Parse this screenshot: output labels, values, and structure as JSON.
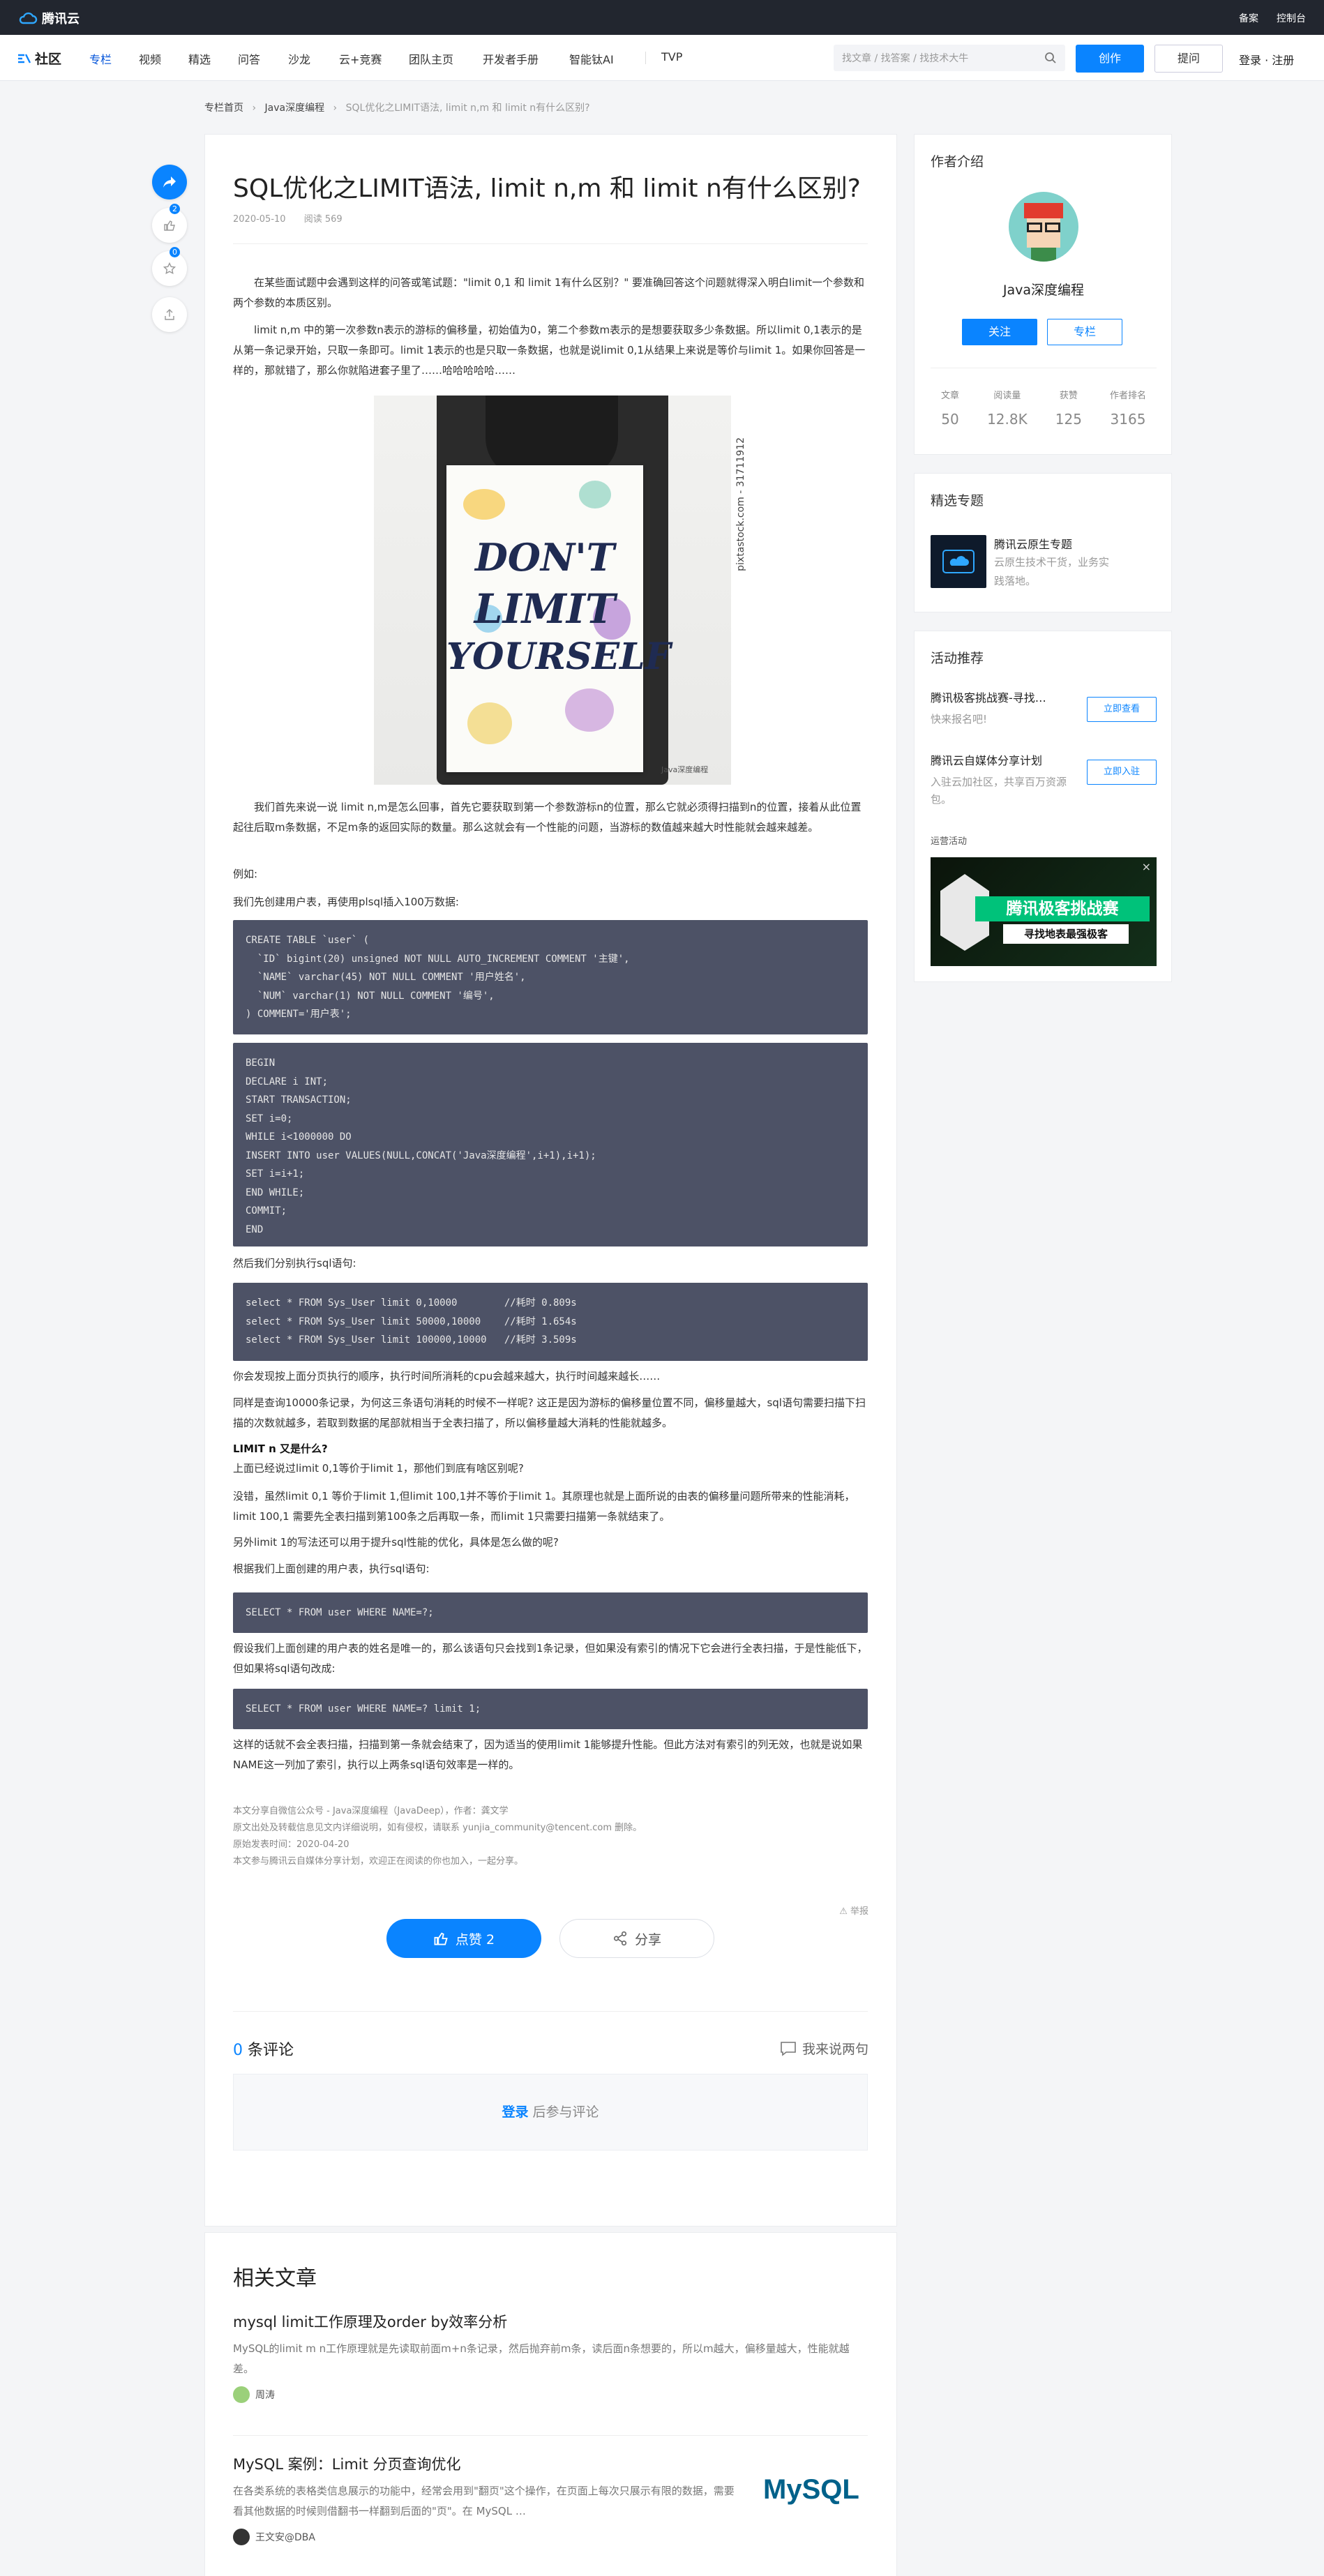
{
  "topbar": {
    "logo": "腾讯云",
    "links": [
      "备案",
      "控制台"
    ]
  },
  "nav": {
    "brand": "社区",
    "items": [
      "专栏",
      "视频",
      "精选",
      "问答",
      "沙龙",
      "云+竞赛",
      "团队主页",
      "开发者手册",
      "智能钛AI",
      "TVP"
    ],
    "search_placeholder": "找文章 / 找答案 / 找技术大牛",
    "create": "创作",
    "ask": "提问",
    "login": "登录 · 注册"
  },
  "breadcrumb": [
    "专栏首页",
    "Java深度编程",
    "SQL优化之LIMIT语法, limit n,m 和 limit n有什么区别?"
  ],
  "floating": {
    "like_count": "2",
    "star_count": "0"
  },
  "article": {
    "title": "SQL优化之LIMIT语法, limit n,m 和 limit n有什么区别?",
    "date": "2020-05-10",
    "reads": "阅读 569",
    "p1": "　　在某些面试题中会遇到这样的问答或笔试题：\"limit 0,1 和 limit 1有什么区别？\" 要准确回答这个问题就得深入明白limit一个参数和两个参数的本质区别。",
    "p2": "　　limit n,m 中的第一次参数n表示的游标的偏移量，初始值为0，第二个参数m表示的是想要获取多少条数据。所以limit 0,1表示的是从第一条记录开始，只取一条即可。limit 1表示的也是只取一条数据，也就是说limit 0,1从结果上来说是等价与limit 1。如果你回答是一样的，那就错了，那么你就陷进套子里了……哈哈哈哈哈……",
    "image": {
      "title_words": [
        "DON'T",
        "LIMIT",
        "YOURSELF"
      ],
      "side_text": "pixtastock.com - 31711912",
      "watermark": "Java深度编程"
    },
    "p3": "　　我们首先来说一说 limit n,m是怎么回事，首先它要获取到第一个参数游标n的位置，那么它就必须得扫描到n的位置，接着从此位置起往后取m条数据，不足m条的返回实际的数量。那么这就会有一个性能的问题，当游标的数值越来越大时性能就会越来越差。",
    "p4": "例如:",
    "p5": "我们先创建用户表，再使用plsql插入100万数据:",
    "p6": "然后我们分别执行sql语句:",
    "p7": "你会发现按上面分页执行的顺序，执行时间所消耗的cpu会越来越大，执行时间越来越长……",
    "p8": "同样是查询10000条记录，为何这三条语句消耗的时候不一样呢? 这正是因为游标的偏移量位置不同，偏移量越大，sql语句需要扫描下扫描的次数就越多，若取到数据的尾部就相当于全表扫描了，所以偏移量越大消耗的性能就越多。",
    "h1": "LIMIT n 又是什么?",
    "p9": "上面已经说过limit 0,1等价于limit 1，那他们到底有啥区别呢?",
    "p10": "没错，虽然limit 0,1 等价于limit 1,但limit 100,1并不等价于limit 1。其原理也就是上面所说的由表的偏移量问题所带来的性能消耗，limit 100,1 需要先全表扫描到第100条之后再取一条，而limit 1只需要扫描第一条就结束了。",
    "p11": "另外limit 1的写法还可以用于提升sql性能的优化，具体是怎么做的呢?",
    "p12": "根据我们上面创建的用户表，执行sql语句:",
    "p13": "假设我们上面创建的用户表的姓名是唯一的，那么该语句只会找到1条记录，但如果没有索引的情况下它会进行全表扫描，于是性能低下，但如果将sql语句改成:",
    "p14": "这样的话就不会全表扫描，扫描到第一条就会结束了，因为适当的使用limit 1能够提升性能。但此方法对有索引的列无效，也就是说如果NAME这一列加了索引，执行以上两条sql语句效率是一样的。",
    "code_create": [
      "CREATE TABLE `user` (",
      "  `ID` bigint(20) unsigned NOT NULL AUTO_INCREMENT COMMENT '主键',",
      "  `NAME` varchar(45) NOT NULL COMMENT '用户姓名',",
      "  `NUM` varchar(1) NOT NULL COMMENT '编号',",
      ") COMMENT='用户表';"
    ],
    "code_plsql": [
      "BEGIN",
      "DECLARE i INT;",
      "START TRANSACTION;",
      "SET i=0;",
      "WHILE i<1000000 DO",
      "INSERT INTO user VALUES(NULL,CONCAT('Java深度编程',i+1),i+1);",
      "SET i=i+1;",
      "END WHILE;",
      "COMMIT;",
      "END"
    ],
    "code_select": [
      "select * FROM Sys_User limit 0,10000        //耗时 0.809s",
      "select * FROM Sys_User limit 50000,10000    //耗时 1.654s",
      "select * FROM Sys_User limit 100000,10000   //耗时 3.509s"
    ],
    "code_q1": "SELECT * FROM user WHERE NAME=?;",
    "code_q2": "SELECT * FROM user WHERE NAME=? limit 1;",
    "source": [
      "本文分享自微信公众号 - Java深度编程（JavaDeep），作者：龚文学",
      "原文出处及转载信息见文内详细说明，如有侵权，请联系 yunjia_community@tencent.com 删除。",
      "原始发表时间：2020-04-20",
      "本文参与腾讯云自媒体分享计划，欢迎正在阅读的你也加入，一起分享。"
    ],
    "source_link": "腾讯云自媒体分享计划",
    "report": "举报",
    "like": "点赞 2",
    "share": "分享",
    "comments_count": "0",
    "comments_label": "条评论",
    "comment_write": "我来说两句",
    "comment_login": "登录",
    "comment_after": "后参与评论"
  },
  "related": {
    "title": "相关文章",
    "items": [
      {
        "title": "mysql limit工作原理及order by效率分析",
        "desc": "MySQL的limit m n工作原理就是先读取前面m+n条记录，然后抛弃前m条，读后面n条想要的，所以m越大，偏移量越大，性能就越差。",
        "author": "周涛"
      },
      {
        "title": "MySQL 案例：Limit 分页查询优化",
        "desc": "在各类系统的表格类信息展示的功能中，经常会用到\"翻页\"这个操作，在页面上每次只展示有限的数据，需要看其他数据的时候则借翻书一样翻到后面的\"页\"。在 MySQL …",
        "author": "王文安@DBA",
        "logo": "MySQL"
      }
    ]
  },
  "sidebar": {
    "author": {
      "heading": "作者介绍",
      "name": "Java深度编程",
      "follow": "关注",
      "column": "专栏",
      "stats": [
        {
          "label": "文章",
          "value": "50"
        },
        {
          "label": "阅读量",
          "value": "12.8K"
        },
        {
          "label": "获赞",
          "value": "125"
        },
        {
          "label": "作者排名",
          "value": "3165"
        }
      ]
    },
    "topics": {
      "heading": "精选专题",
      "title": "腾讯云原生专题",
      "desc": "云原生技术干货，业务实践落地。"
    },
    "activities": {
      "heading": "活动推荐",
      "items": [
        {
          "title": "腾讯极客挑战赛-寻找…",
          "desc": "快来报名吧!",
          "button": "立即查看"
        },
        {
          "title": "腾讯云自媒体分享计划",
          "desc": "入驻云加社区，共享百万资源包。",
          "button": "立即入驻"
        }
      ],
      "ops_label": "运营活动",
      "banner_title": "腾讯极客挑战赛",
      "banner_sub": "寻找地表最强极客"
    }
  }
}
